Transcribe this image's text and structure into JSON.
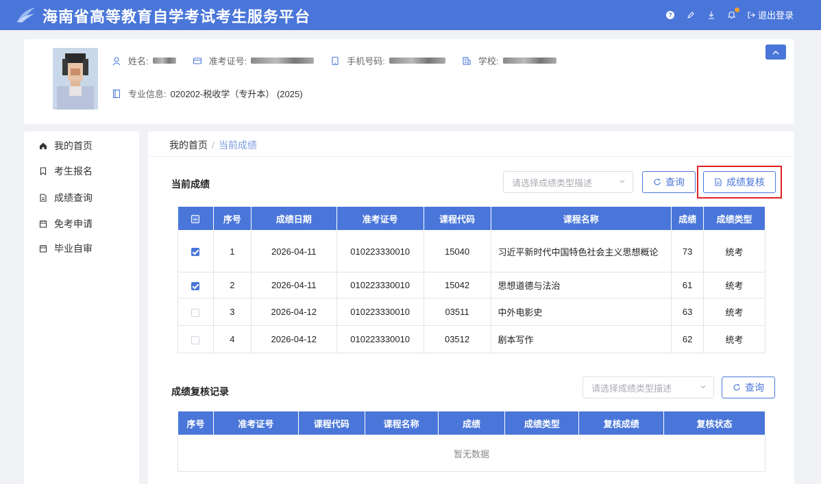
{
  "header": {
    "title": "海南省高等教育自学考试考生服务平台",
    "help_icon": "?",
    "logout_label": "退出登录"
  },
  "profile": {
    "name_label": "姓名:",
    "ticket_label": "准考证号:",
    "phone_label": "手机号码:",
    "school_label": "学校:",
    "major_label": "专业信息:",
    "major_value": "020202-税收学（专升本） (2025)"
  },
  "sidebar": {
    "items": [
      {
        "label": "我的首页",
        "icon": "home-icon"
      },
      {
        "label": "考生报名",
        "icon": "bookmark-icon"
      },
      {
        "label": "成绩查询",
        "icon": "document-icon"
      },
      {
        "label": "免考申请",
        "icon": "calendar-icon"
      },
      {
        "label": "毕业自审",
        "icon": "calendar-icon"
      }
    ]
  },
  "breadcrumb": {
    "home": "我的首页",
    "sep": "/",
    "current": "当前成绩"
  },
  "current": {
    "title": "当前成绩",
    "select_placeholder": "请选择成绩类型描述",
    "query_label": "查询",
    "review_label": "成绩复核",
    "columns": [
      "序号",
      "成绩日期",
      "准考证号",
      "课程代码",
      "课程名称",
      "成绩",
      "成绩类型"
    ],
    "rows": [
      {
        "checked": true,
        "no": "1",
        "date": "2026-04-11",
        "ticket": "010223330010",
        "code": "15040",
        "name": "习近平新时代中国特色社会主义思想概论",
        "score": "73",
        "type": "统考"
      },
      {
        "checked": true,
        "no": "2",
        "date": "2026-04-11",
        "ticket": "010223330010",
        "code": "15042",
        "name": "思想道德与法治",
        "score": "61",
        "type": "统考"
      },
      {
        "checked": false,
        "no": "3",
        "date": "2026-04-12",
        "ticket": "010223330010",
        "code": "03511",
        "name": "中外电影史",
        "score": "63",
        "type": "统考"
      },
      {
        "checked": false,
        "no": "4",
        "date": "2026-04-12",
        "ticket": "010223330010",
        "code": "03512",
        "name": "剧本写作",
        "score": "62",
        "type": "统考"
      }
    ]
  },
  "review": {
    "title": "成绩复核记录",
    "select_placeholder": "请选择成绩类型描述",
    "query_label": "查询",
    "columns": [
      "序号",
      "准考证号",
      "课程代码",
      "课程名称",
      "成绩",
      "成绩类型",
      "复核成绩",
      "复核状态"
    ],
    "empty_text": "暂无数据"
  },
  "colors": {
    "primary": "#4a76d9",
    "highlight": "#e02020"
  }
}
